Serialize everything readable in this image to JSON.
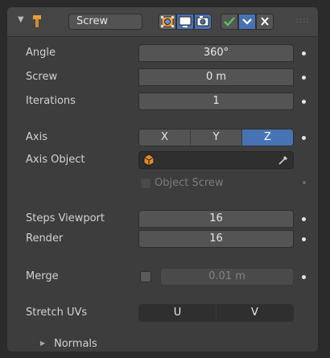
{
  "header": {
    "name_value": "Screw",
    "menu_dots": "::::"
  },
  "fields": {
    "angle": {
      "label": "Angle",
      "value": "360°"
    },
    "screw": {
      "label": "Screw",
      "value": "0 m"
    },
    "iterations": {
      "label": "Iterations",
      "value": "1"
    }
  },
  "axis": {
    "label": "Axis",
    "options": [
      "X",
      "Y",
      "Z"
    ],
    "selected": "Z"
  },
  "axis_object": {
    "label": "Axis Object",
    "value": ""
  },
  "object_screw": {
    "label": "Object Screw",
    "checked": false
  },
  "steps": {
    "viewport": {
      "label": "Steps Viewport",
      "value": "16"
    },
    "render": {
      "label": "Render",
      "value": "16"
    }
  },
  "merge": {
    "label": "Merge",
    "value": "0.01 m",
    "checked": false
  },
  "stretch_uvs": {
    "label": "Stretch UVs",
    "options": [
      "U",
      "V"
    ]
  },
  "normals": {
    "label": "Normals"
  },
  "colors": {
    "panel_bg": "#3d3d3d",
    "field_bg": "#545454",
    "accent_blue": "#4772b3",
    "check_green": "#59c45a"
  },
  "icons": [
    "collapse-triangle-icon",
    "wrench-icon",
    "cage-edit-icon",
    "viewport-display-icon",
    "render-icon",
    "checkmark-icon",
    "chevron-down-icon",
    "close-icon",
    "object-icon",
    "eyedropper-icon"
  ]
}
